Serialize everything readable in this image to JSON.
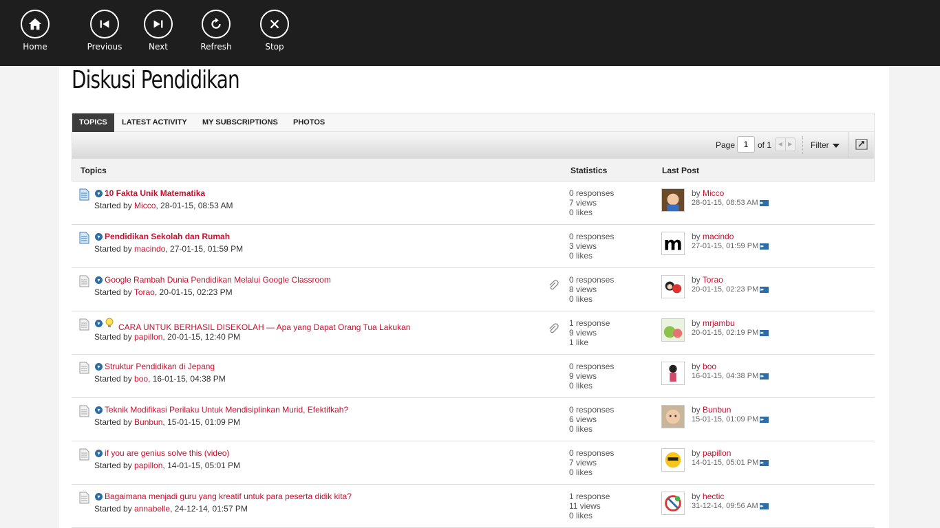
{
  "appbar": {
    "buttons": [
      {
        "label": "Home",
        "icon": "home-icon"
      },
      {
        "label": "Previous",
        "icon": "previous-icon"
      },
      {
        "label": "Next",
        "icon": "next-icon"
      },
      {
        "label": "Refresh",
        "icon": "refresh-icon"
      },
      {
        "label": "Stop",
        "icon": "stop-icon"
      }
    ]
  },
  "page": {
    "title": "Diskusi Pendidikan",
    "tabs": [
      "TOPICS",
      "LATEST ACTIVITY",
      "MY SUBSCRIPTIONS",
      "PHOTOS"
    ],
    "pagination": {
      "label": "Page",
      "current": "1",
      "of": "of 1"
    },
    "filter_label": "Filter",
    "columns": {
      "topics": "Topics",
      "statistics": "Statistics",
      "last_post": "Last Post"
    }
  },
  "colors": {
    "link": "#c8102e",
    "accent": "#2e6da4",
    "appbar": "#1e1e1e"
  },
  "topics": [
    {
      "title": "10 Fakta Unik Matematika",
      "started_prefix": "Started by ",
      "author": "Micco",
      "started": ", 28-01-15, 08:53 AM",
      "s1": "0 responses",
      "s2": "7 views",
      "s3": "0 likes",
      "by": "by ",
      "lp_user": "Micco",
      "lp_date": "28-01-15, 08:53 AM"
    },
    {
      "title": "Pendidikan Sekolah dan Rumah",
      "started_prefix": "Started by ",
      "author": "macindo",
      "started": ", 27-01-15, 01:59 PM",
      "s1": "0 responses",
      "s2": "3 views",
      "s3": "0 likes",
      "by": "by ",
      "lp_user": "macindo",
      "lp_date": "27-01-15, 01:59 PM"
    },
    {
      "title": "Google Rambah Dunia Pendidikan Melalui Google Classroom",
      "started_prefix": "Started by ",
      "author": "Torao",
      "started": ", 20-01-15, 02:23 PM",
      "s1": "0 responses",
      "s2": "8 views",
      "s3": "0 likes",
      "by": "by ",
      "lp_user": "Torao",
      "lp_date": "20-01-15, 02:23 PM"
    },
    {
      "title": "CARA UNTUK BERHASIL DISEKOLAH — Apa yang Dapat Orang Tua Lakukan",
      "started_prefix": "Started by ",
      "author": "papillon",
      "started": ", 20-01-15, 12:40 PM",
      "s1": "1 response",
      "s2": "9 views",
      "s3": "1 like",
      "by": "by ",
      "lp_user": "mrjambu",
      "lp_date": "20-01-15, 02:19 PM"
    },
    {
      "title": "Struktur Pendidikan di Jepang",
      "started_prefix": "Started by ",
      "author": "boo",
      "started": ", 16-01-15, 04:38 PM",
      "s1": "0 responses",
      "s2": "9 views",
      "s3": "0 likes",
      "by": "by ",
      "lp_user": "boo",
      "lp_date": "16-01-15, 04:38 PM"
    },
    {
      "title": "Teknik Modifikasi Perilaku Untuk Mendisiplinkan Murid, Efektifkah?",
      "started_prefix": "Started by ",
      "author": "Bunbun",
      "started": ", 15-01-15, 01:09 PM",
      "s1": "0 responses",
      "s2": "6 views",
      "s3": "0 likes",
      "by": "by ",
      "lp_user": "Bunbun",
      "lp_date": "15-01-15, 01:09 PM"
    },
    {
      "title": "if you are genius solve this (video)",
      "started_prefix": "Started by ",
      "author": "papillon",
      "started": ", 14-01-15, 05:01 PM",
      "s1": "0 responses",
      "s2": "7 views",
      "s3": "0 likes",
      "by": "by ",
      "lp_user": "papillon",
      "lp_date": "14-01-15, 05:01 PM"
    },
    {
      "title": "Bagaimana menjadi guru yang kreatif untuk para peserta didik kita?",
      "started_prefix": "Started by ",
      "author": "annabelle",
      "started": ", 24-12-14, 01:57 PM",
      "s1": "1 response",
      "s2": "11 views",
      "s3": "0 likes",
      "by": "by ",
      "lp_user": "hectic",
      "lp_date": "31-12-14, 09:56 AM"
    }
  ]
}
